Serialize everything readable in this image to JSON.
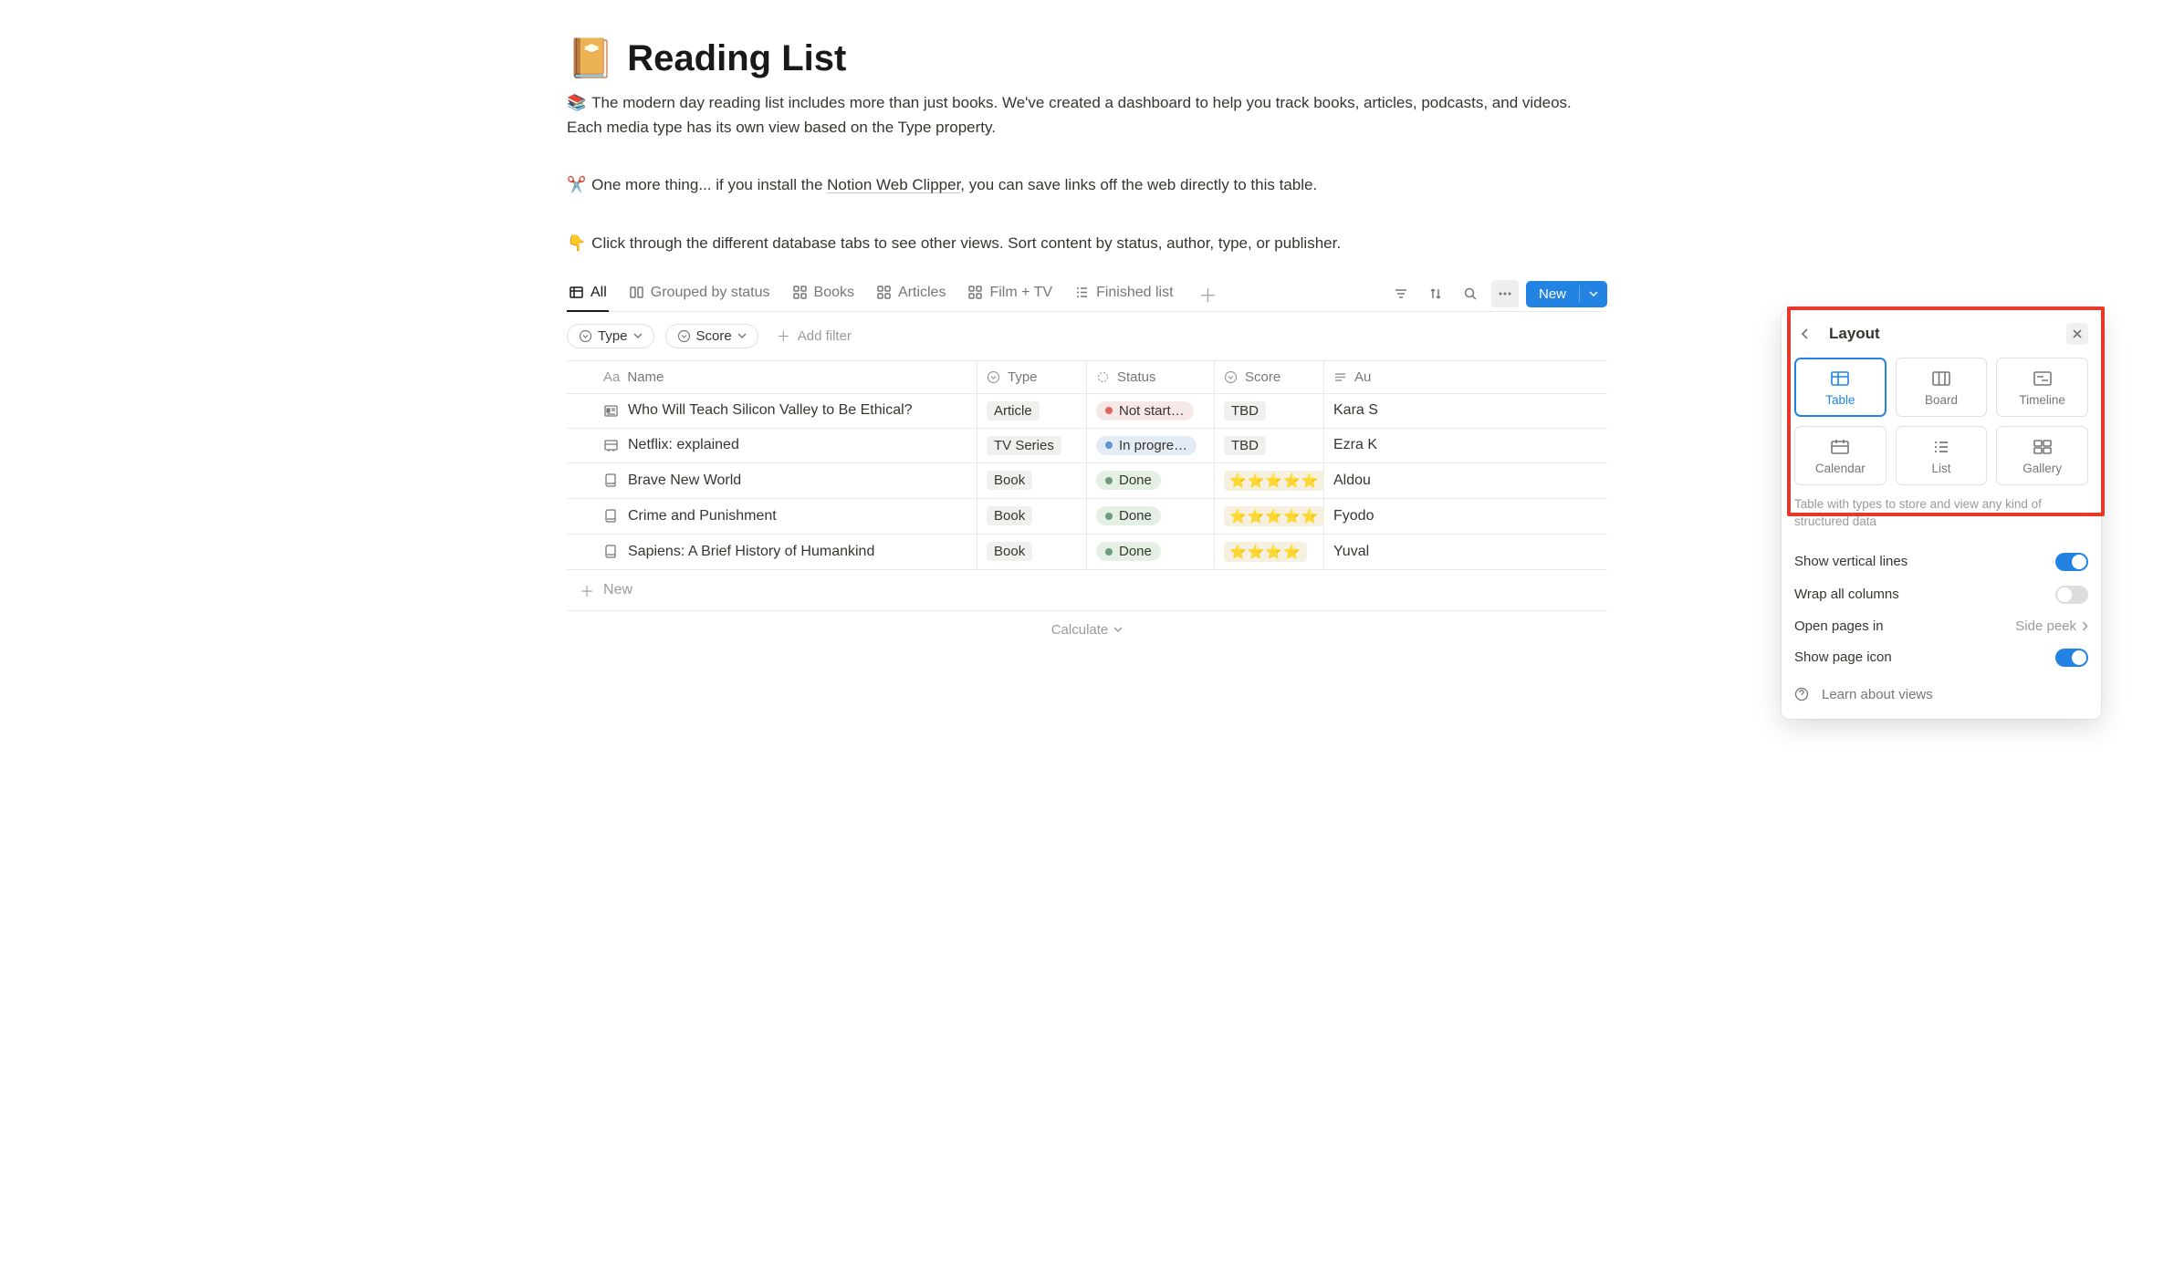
{
  "page": {
    "icon": "📔",
    "title": "Reading List",
    "desc1_emoji": "📚",
    "desc1": "The modern day reading list includes more than just books. We've created a dashboard to help you track books, articles, podcasts, and videos. Each media type has its own view based on the Type property.",
    "desc2_emoji": "✂️",
    "desc2_pre": "One more thing... if you install the ",
    "desc2_link": "Notion Web Clipper",
    "desc2_post": ", you can save links off the web directly to this table.",
    "desc3_emoji": "👇",
    "desc3": "Click through the different database tabs to see other views. Sort content by status, author, type, or publisher."
  },
  "tabs": [
    {
      "label": "All",
      "active": true
    },
    {
      "label": "Grouped by status",
      "active": false
    },
    {
      "label": "Books",
      "active": false
    },
    {
      "label": "Articles",
      "active": false
    },
    {
      "label": "Film + TV",
      "active": false
    },
    {
      "label": "Finished list",
      "active": false
    }
  ],
  "toolbar": {
    "new_label": "New"
  },
  "filters": {
    "type_label": "Type",
    "score_label": "Score",
    "add_filter": "Add filter"
  },
  "columns": {
    "name": "Name",
    "type": "Type",
    "status": "Status",
    "score": "Score",
    "author": "Au"
  },
  "rows": [
    {
      "icon": "article",
      "name": "Who Will Teach Silicon Valley to Be Ethical?",
      "type": "Article",
      "status": "Not start…",
      "status_class": "not-started",
      "score": "TBD",
      "score_stars": false,
      "author": "Kara S"
    },
    {
      "icon": "tv",
      "name": "Netflix: explained",
      "type": "TV Series",
      "status": "In progre…",
      "status_class": "in-progress",
      "score": "TBD",
      "score_stars": false,
      "author": "Ezra K"
    },
    {
      "icon": "book",
      "name": "Brave New World",
      "type": "Book",
      "status": "Done",
      "status_class": "done",
      "score": "⭐⭐⭐⭐⭐",
      "score_stars": true,
      "author": "Aldou"
    },
    {
      "icon": "book",
      "name": "Crime and Punishment",
      "type": "Book",
      "status": "Done",
      "status_class": "done",
      "score": "⭐⭐⭐⭐⭐",
      "score_stars": true,
      "author": "Fyodo"
    },
    {
      "icon": "book",
      "name": "Sapiens: A Brief History of Humankind",
      "type": "Book",
      "status": "Done",
      "status_class": "done",
      "score": "⭐⭐⭐⭐",
      "score_stars": true,
      "author": "Yuval"
    }
  ],
  "new_row_label": "New",
  "calculate_label": "Calculate",
  "panel": {
    "title": "Layout",
    "options": [
      {
        "label": "Table",
        "selected": true
      },
      {
        "label": "Board",
        "selected": false
      },
      {
        "label": "Timeline",
        "selected": false
      },
      {
        "label": "Calendar",
        "selected": false
      },
      {
        "label": "List",
        "selected": false
      },
      {
        "label": "Gallery",
        "selected": false
      }
    ],
    "hint": "Table with types to store and view any kind of structured data",
    "settings": {
      "vertical_lines": {
        "label": "Show vertical lines",
        "on": true
      },
      "wrap_columns": {
        "label": "Wrap all columns",
        "on": false
      },
      "open_pages": {
        "label": "Open pages in",
        "value": "Side peek"
      },
      "show_icon": {
        "label": "Show page icon",
        "on": true
      }
    },
    "learn": "Learn about views"
  }
}
